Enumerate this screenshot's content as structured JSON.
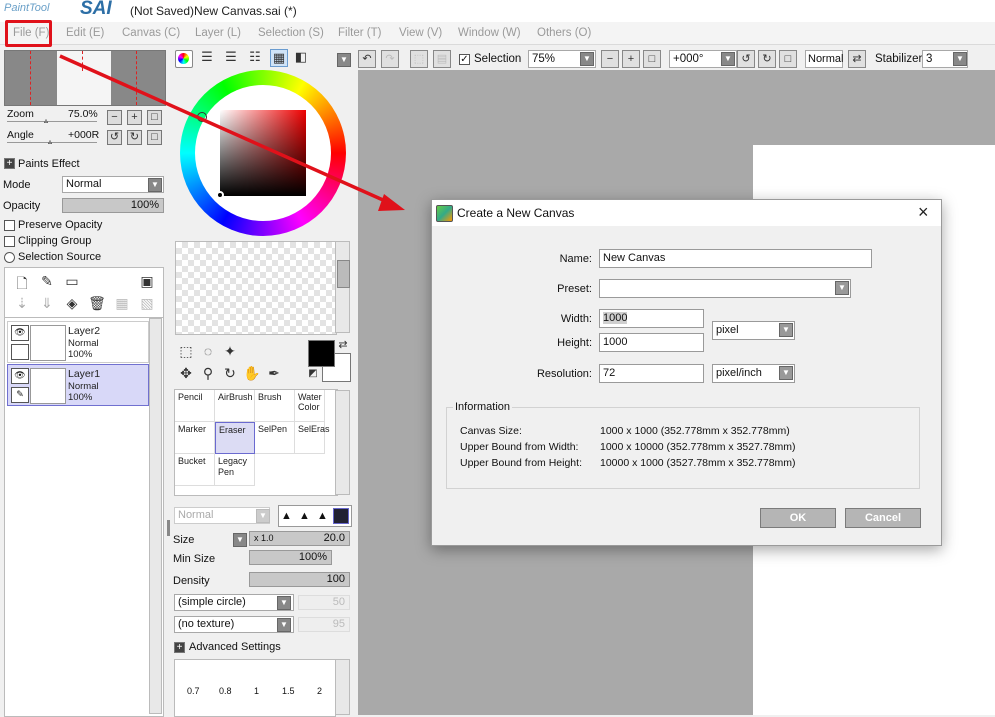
{
  "app": {
    "logo_text": "PaintTool",
    "logo_sai": "SAI",
    "window_title": "(Not Saved)New Canvas.sai (*)"
  },
  "menu": [
    "File (F)",
    "Edit (E)",
    "Canvas (C)",
    "Layer (L)",
    "Selection (S)",
    "Filter (T)",
    "View (V)",
    "Window (W)",
    "Others (O)"
  ],
  "navigator": {
    "zoom_label": "Zoom",
    "zoom_value": "75.0%",
    "angle_label": "Angle",
    "angle_value": "+000R"
  },
  "layer_props": {
    "paints_effect": "Paints Effect",
    "mode_label": "Mode",
    "mode_value": "Normal",
    "opacity_label": "Opacity",
    "opacity_value": "100%",
    "preserve_opacity": "Preserve Opacity",
    "clipping_group": "Clipping Group",
    "selection_source": "Selection Source"
  },
  "layers": [
    {
      "name": "Layer2",
      "mode": "Normal",
      "opacity": "100%"
    },
    {
      "name": "Layer1",
      "mode": "Normal",
      "opacity": "100%"
    }
  ],
  "tools": [
    {
      "label": "Pencil"
    },
    {
      "label": "AirBrush"
    },
    {
      "label": "Brush"
    },
    {
      "label": "Water Color"
    },
    {
      "label": "Marker"
    },
    {
      "label": "Eraser"
    },
    {
      "label": "SelPen"
    },
    {
      "label": "SelEras"
    },
    {
      "label": "Bucket"
    },
    {
      "label": "Legacy Pen"
    }
  ],
  "brush": {
    "blend_mode": "Normal",
    "size_label": "Size",
    "size_mult": "x 1.0",
    "size_value": "20.0",
    "min_size_label": "Min Size",
    "min_size_value": "100%",
    "density_label": "Density",
    "density_value": "100",
    "shape": "(simple circle)",
    "shape_value": "50",
    "texture": "(no texture)",
    "texture_value": "95",
    "advanced": "Advanced Settings",
    "size_presets": [
      "0.7",
      "0.8",
      "1",
      "1.5",
      "2"
    ]
  },
  "toolbar": {
    "selection_label": "Selection",
    "zoom_value": "75%",
    "angle_value": "+000°",
    "blend_value": "Normal",
    "stabilizer_label": "Stabilizer",
    "stabilizer_value": "3"
  },
  "dialog": {
    "title": "Create a New Canvas",
    "name_label": "Name:",
    "name_value": "New Canvas",
    "preset_label": "Preset:",
    "preset_value": "",
    "width_label": "Width:",
    "width_value": "1000",
    "height_label": "Height:",
    "height_value": "1000",
    "unit_value": "pixel",
    "resolution_label": "Resolution:",
    "resolution_value": "72",
    "resolution_unit": "pixel/inch",
    "info_title": "Information",
    "info": [
      {
        "label": "Canvas Size:",
        "value": "1000 x 1000 (352.778mm x 352.778mm)"
      },
      {
        "label": "Upper Bound from Width:",
        "value": "1000 x 10000 (352.778mm x 3527.78mm)"
      },
      {
        "label": "Upper Bound from Height:",
        "value": "10000 x 1000 (3527.78mm x 352.778mm)"
      }
    ],
    "ok_label": "OK",
    "cancel_label": "Cancel"
  },
  "colors": {
    "annotation_red": "#e0111a",
    "dialog_button": "#b5b5b5",
    "layer_selected": "#d8d8f8"
  }
}
